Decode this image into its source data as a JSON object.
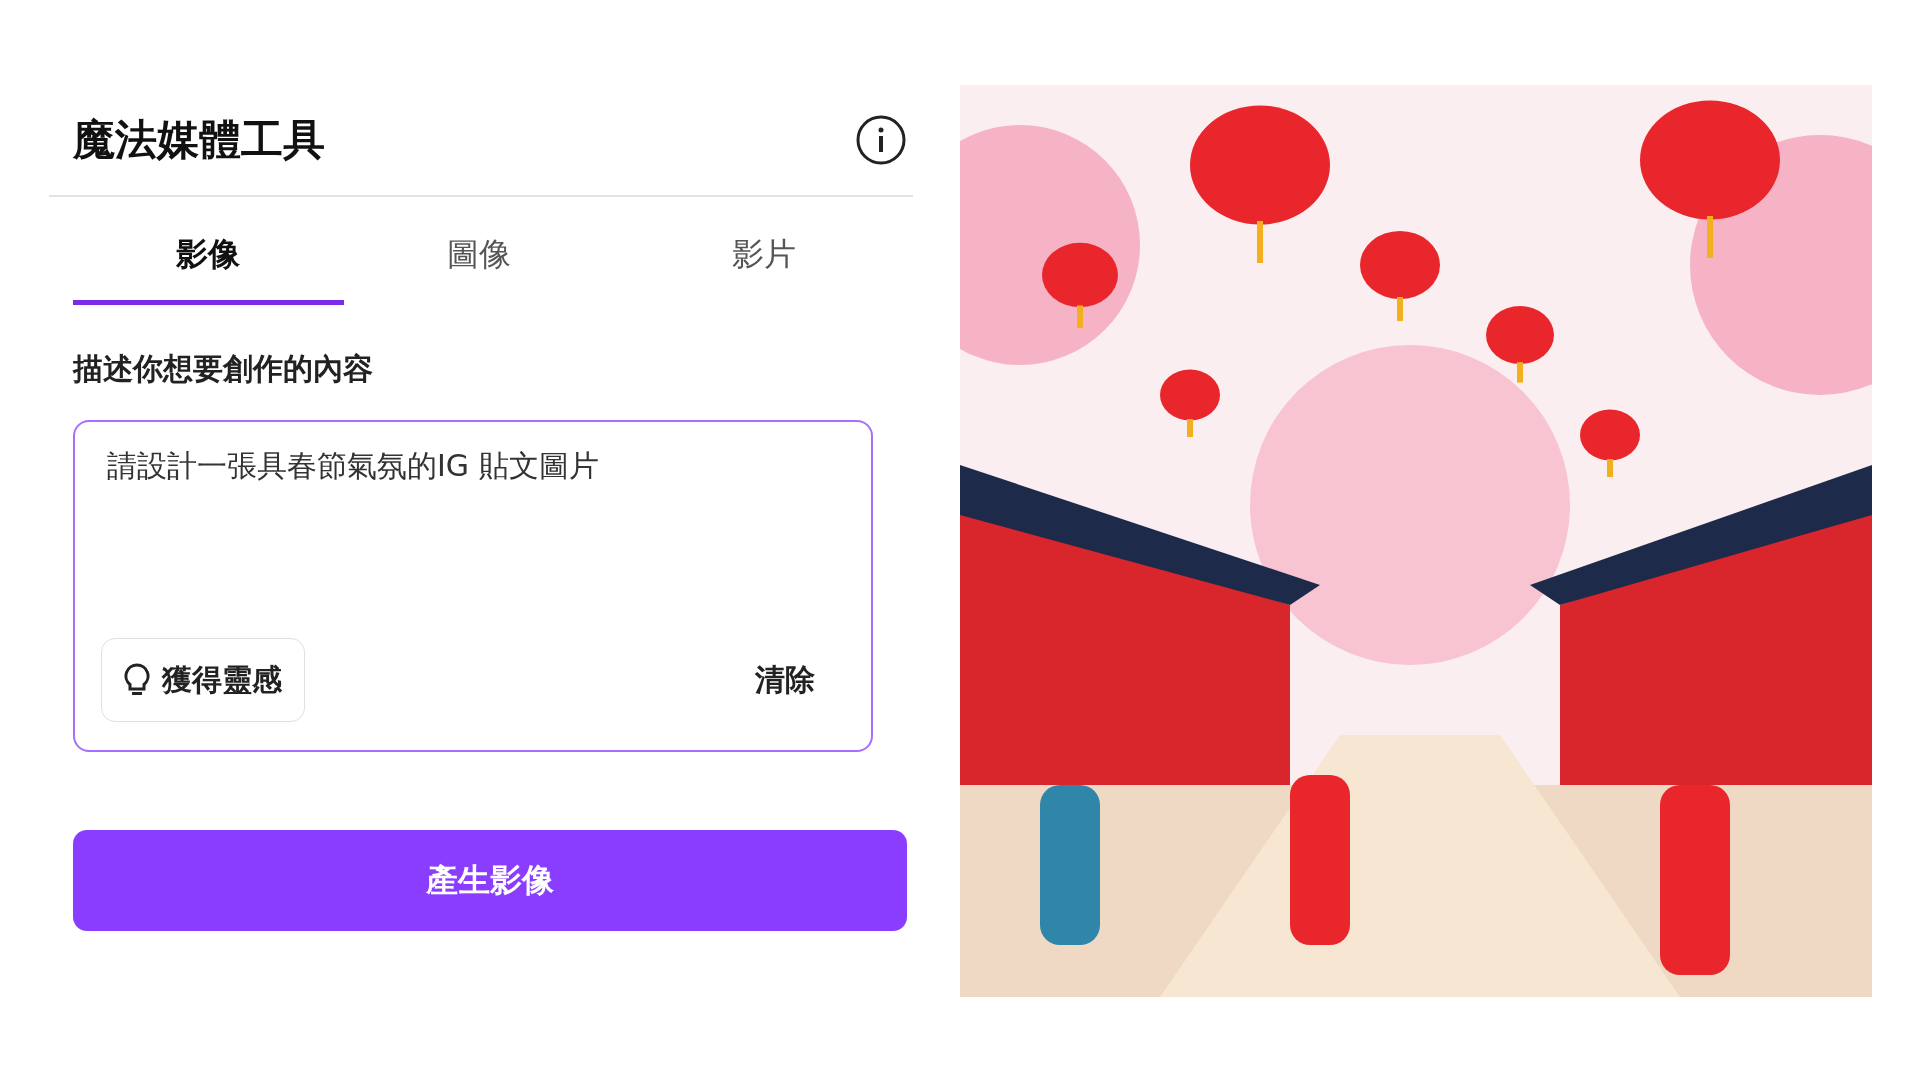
{
  "panel": {
    "title": "魔法媒體工具"
  },
  "tabs": [
    {
      "label": "影像",
      "selected": true
    },
    {
      "label": "圖像",
      "selected": false
    },
    {
      "label": "影片",
      "selected": false
    }
  ],
  "prompt": {
    "label": "描述你想要創作的內容",
    "value": "請設計一張具春節氣氛的IG 貼文圖片",
    "inspire_button": "獲得靈感",
    "clear_button": "清除"
  },
  "generate_button": "產生影像"
}
